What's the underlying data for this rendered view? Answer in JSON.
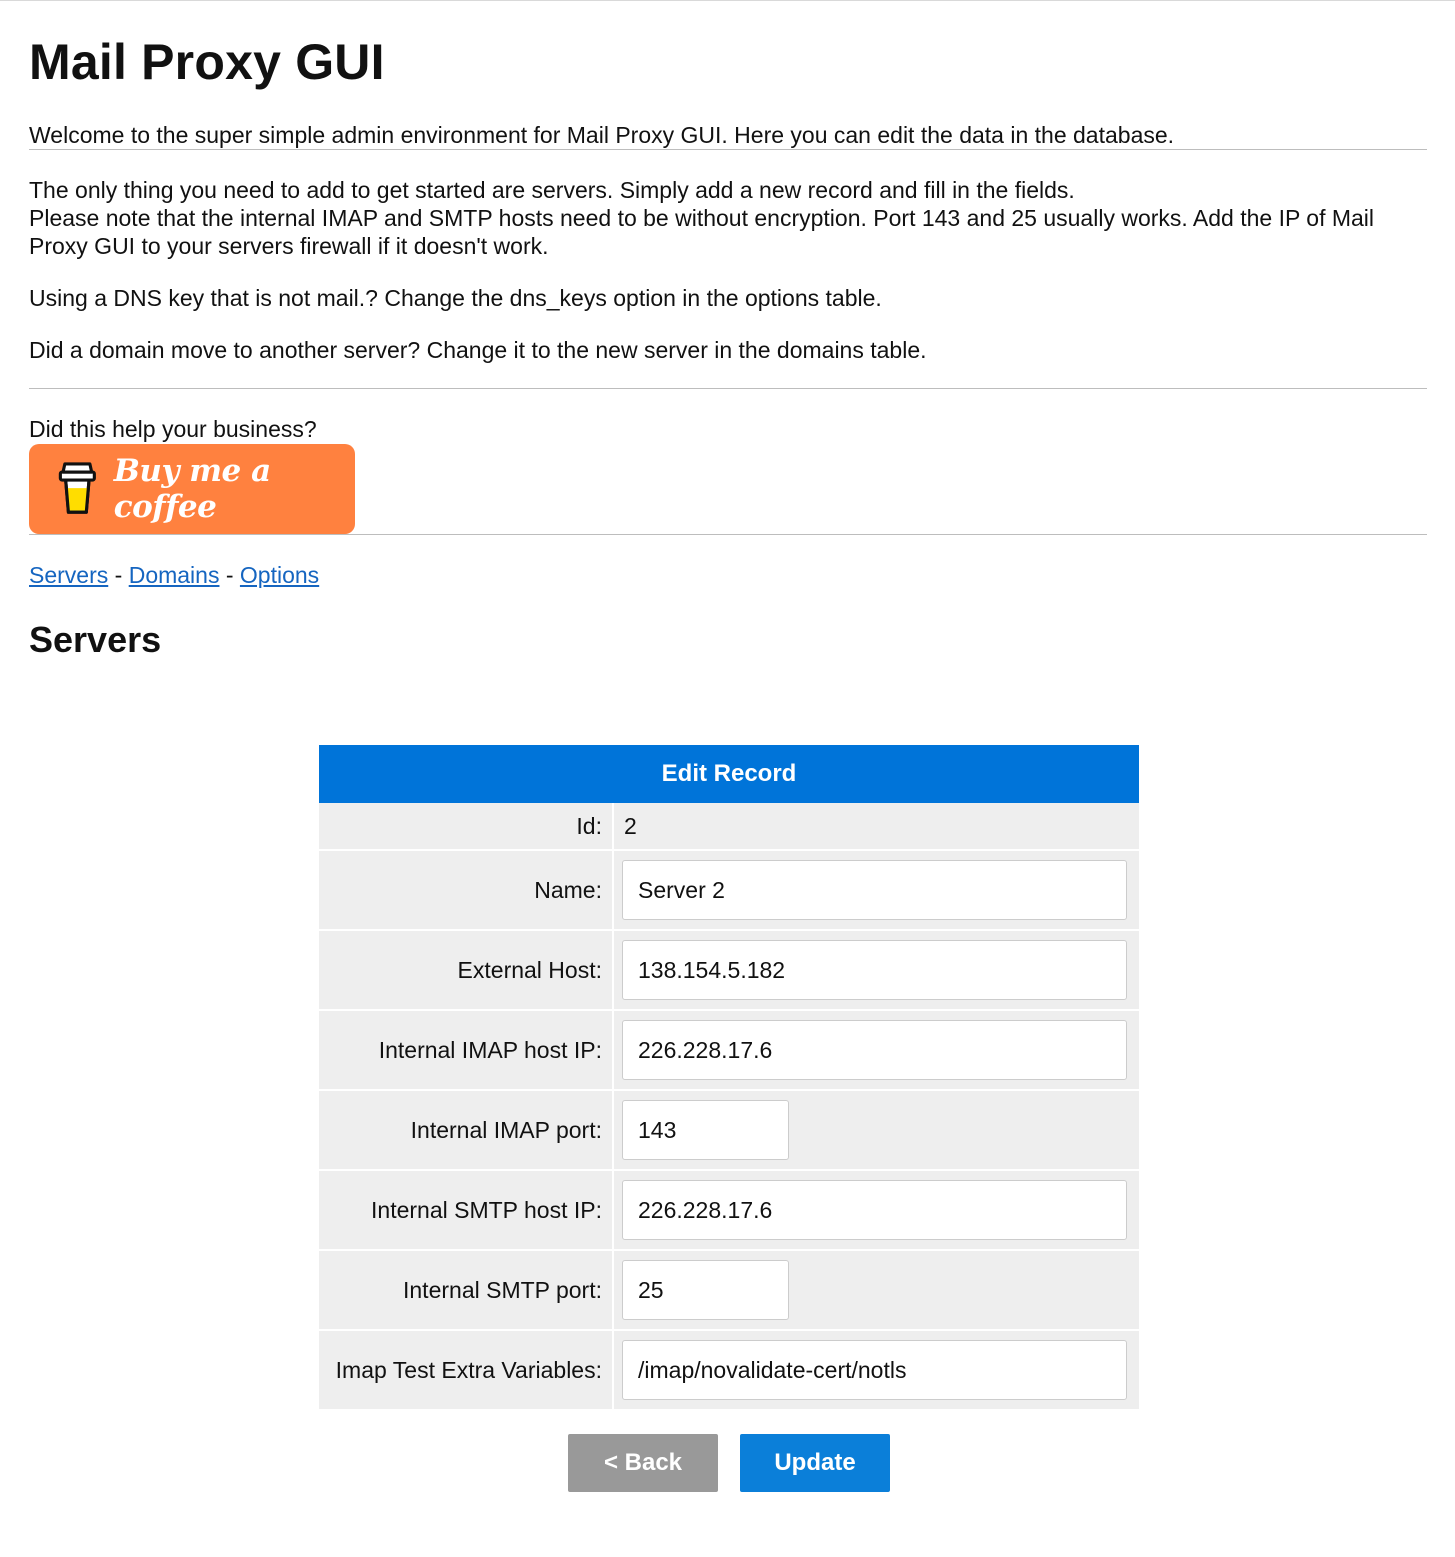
{
  "app": {
    "title": "Mail Proxy GUI",
    "welcome": "Welcome to the super simple admin environment for Mail Proxy GUI. Here you can edit the data in the database."
  },
  "intro": {
    "line1": "The only thing you need to add to get started are servers. Simply add a new record and fill in the fields.",
    "line2": "Please note that the internal IMAP and SMTP hosts need to be without encryption. Port 143 and 25 usually works. Add the IP of Mail Proxy GUI to your servers firewall if it doesn't work.",
    "dns_note": "Using a DNS key that is not mail.? Change the dns_keys option in the options table.",
    "domain_note": "Did a domain move to another server? Change it to the new server in the domains table."
  },
  "support": {
    "question": "Did this help your business?",
    "button_label": "Buy me a coffee",
    "button_color": "#ff813f"
  },
  "nav": {
    "items": [
      {
        "label": "Servers"
      },
      {
        "label": "Domains"
      },
      {
        "label": "Options"
      }
    ],
    "separator": "-"
  },
  "section_title": "Servers",
  "record": {
    "header": "Edit Record",
    "header_color": "#0074d9",
    "id_label": "Id:",
    "id_value": "2",
    "fields": {
      "name": {
        "label": "Name:",
        "value": "Server 2"
      },
      "external_host": {
        "label": "External Host:",
        "value": "138.154.5.182"
      },
      "imap_host": {
        "label": "Internal IMAP host IP:",
        "value": "226.228.17.6"
      },
      "imap_port": {
        "label": "Internal IMAP port:",
        "value": "143"
      },
      "smtp_host": {
        "label": "Internal SMTP host IP:",
        "value": "226.228.17.6"
      },
      "smtp_port": {
        "label": "Internal SMTP port:",
        "value": "25"
      },
      "imap_extra": {
        "label": "Imap Test Extra Variables:",
        "value": "/imap/novalidate-cert/notls"
      }
    }
  },
  "buttons": {
    "back_label": "< Back",
    "update_label": "Update"
  }
}
